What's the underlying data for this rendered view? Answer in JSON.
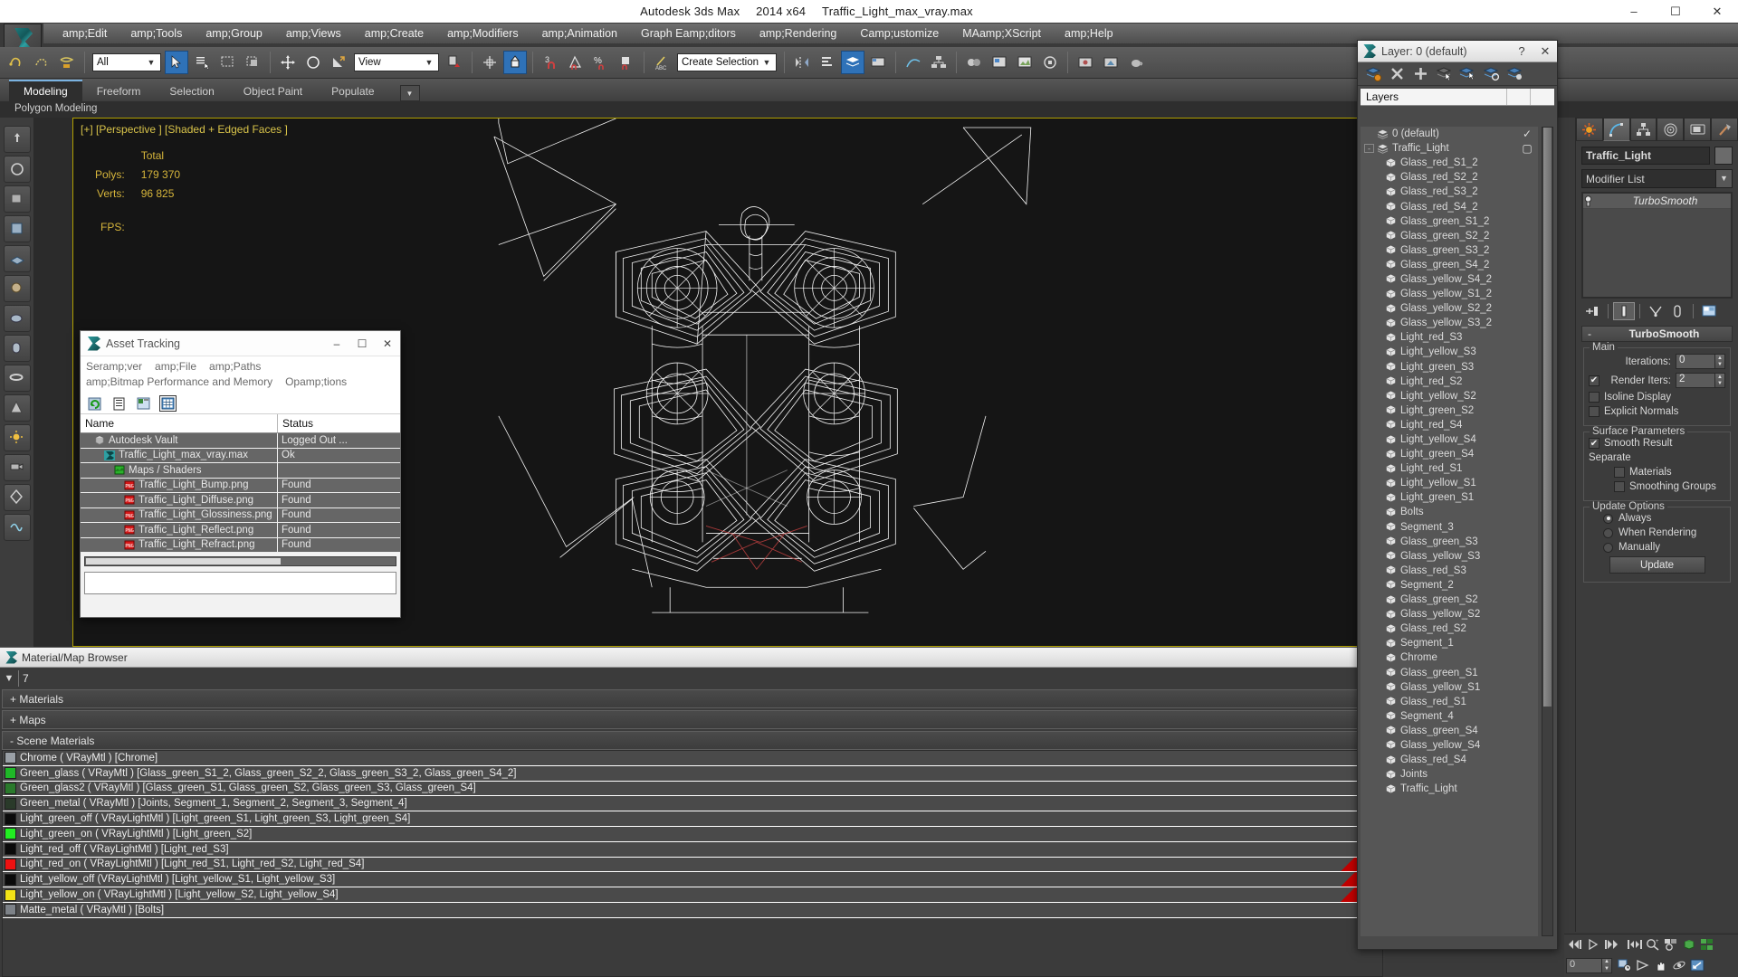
{
  "titlebar": {
    "app": "Autodesk 3ds Max",
    "version": "2014 x64",
    "file": "Traffic_Light_max_vray.max",
    "minimize": "–",
    "maximize": "☐",
    "close": "✕"
  },
  "menu": {
    "items": [
      "amp;Edit",
      "amp;Tools",
      "amp;Group",
      "amp;Views",
      "amp;Create",
      "amp;Modifiers",
      "amp;Animation",
      "Graph Eamp;ditors",
      "amp;Rendering",
      "Camp;ustomize",
      "MAamp;XScript",
      "amp;Help"
    ]
  },
  "toolbar": {
    "selection_filter": "All",
    "ref_coord_sys": "View",
    "named_selection_set": "Create Selection Se",
    "icons": [
      "undo-icon",
      "redo-icon",
      "select-link-icon",
      "unlink-icon",
      "bind-spacewarp-icon",
      "select-object-icon",
      "select-by-name-icon",
      "rect-selection-icon",
      "window-crossing-icon",
      "select-move-icon",
      "select-rotate-icon",
      "select-scale-icon",
      "use-pivot-icon",
      "use-center-icon",
      "snap-toggle-icon",
      "angle-snap-icon",
      "percent-snap-icon",
      "spinner-snap-icon",
      "named-sel-icon",
      "mirror-icon",
      "align-icon",
      "manage-layers-icon",
      "graphite-tools-icon",
      "curve-editor-icon",
      "schematic-view-icon",
      "material-editor-icon",
      "render-setup-icon",
      "render-frame-icon",
      "render-production-icon"
    ]
  },
  "ribbon": {
    "tabs": [
      "Modeling",
      "Freeform",
      "Selection",
      "Object Paint",
      "Populate"
    ],
    "active_tab": "Modeling",
    "subtitle": "Polygon Modeling",
    "more": "▼"
  },
  "viewport": {
    "label": "[+] [Perspective ] [Shaded + Edged Faces ]",
    "stats_header": "Total",
    "polys_label": "Polys:",
    "polys_value": "179 370",
    "verts_label": "Verts:",
    "verts_value": "96 825",
    "fps_label": "FPS:",
    "fps_value": ""
  },
  "asset_tracking": {
    "title": "Asset Tracking",
    "icon": "max-file-icon",
    "minimize": "–",
    "maximize": "☐",
    "close": "✕",
    "menu_line1": [
      "Seramp;ver",
      "amp;File",
      "amp;Paths"
    ],
    "menu_line2": [
      "amp;Bitmap Performance and Memory",
      "Opamp;tions"
    ],
    "tool_icons": [
      "refresh-icon",
      "list-view-icon",
      "details-view-icon",
      "grid-view-icon"
    ],
    "columns": [
      "Name",
      "Status"
    ],
    "rows": [
      {
        "name": "Autodesk Vault",
        "status": "Logged Out ...",
        "indent": 1,
        "icon": "vault-icon"
      },
      {
        "name": "Traffic_Light_max_vray.max",
        "status": "Ok",
        "indent": 2,
        "icon": "max-file-icon"
      },
      {
        "name": "Maps / Shaders",
        "status": "",
        "indent": 3,
        "icon": "maps-icon"
      },
      {
        "name": "Traffic_Light_Bump.png",
        "status": "Found",
        "indent": 4,
        "icon": "png-icon"
      },
      {
        "name": "Traffic_Light_Diffuse.png",
        "status": "Found",
        "indent": 4,
        "icon": "png-icon"
      },
      {
        "name": "Traffic_Light_Glossiness.png",
        "status": "Found",
        "indent": 4,
        "icon": "png-icon"
      },
      {
        "name": "Traffic_Light_Reflect.png",
        "status": "Found",
        "indent": 4,
        "icon": "png-icon"
      },
      {
        "name": "Traffic_Light_Refract.png",
        "status": "Found",
        "indent": 4,
        "icon": "png-icon"
      }
    ]
  },
  "material_browser": {
    "title": "Material/Map Browser",
    "icon": "max-file-icon",
    "close": "✕",
    "search_value": "7",
    "search_arrow": "▼",
    "groups": [
      {
        "sign": "+",
        "label": "Materials"
      },
      {
        "sign": "+",
        "label": "Maps"
      },
      {
        "sign": "-",
        "label": "Scene Materials"
      }
    ],
    "materials": [
      {
        "name": "Chrome",
        "type": "( VRayMtl )",
        "objects": "[Chrome]",
        "swatch": "#9aa0a6",
        "red": false
      },
      {
        "name": "Green_glass",
        "type": "( VRayMtl )",
        "objects": "[Glass_green_S1_2, Glass_green_S2_2, Glass_green_S3_2, Glass_green_S4_2]",
        "swatch": "#1fb728",
        "red": false
      },
      {
        "name": "Green_glass2",
        "type": "( VRayMtl )",
        "objects": "[Glass_green_S1, Glass_green_S2, Glass_green_S3, Glass_green_S4]",
        "swatch": "#2a7a2c",
        "red": false
      },
      {
        "name": "Green_metal",
        "type": "( VRayMtl )",
        "objects": "[Joints, Segment_1, Segment_2, Segment_3, Segment_4]",
        "swatch": "#2a3a2a",
        "red": false
      },
      {
        "name": "Light_green_off",
        "type": "( VRayLightMtl )",
        "objects": "[Light_green_S1, Light_green_S3, Light_green_S4]",
        "swatch": "#0a0a0a",
        "red": false
      },
      {
        "name": "Light_green_on",
        "type": "( VRayLightMtl )",
        "objects": "[Light_green_S2]",
        "swatch": "#22ee22",
        "red": false
      },
      {
        "name": "Light_red_off",
        "type": "( VRayLightMtl )",
        "objects": "[Light_red_S3]",
        "swatch": "#0a0a0a",
        "red": false
      },
      {
        "name": "Light_red_on",
        "type": "( VRayLightMtl )",
        "objects": "[Light_red_S1, Light_red_S2, Light_red_S4]",
        "swatch": "#ee1111",
        "red": true
      },
      {
        "name": "Light_yellow_off",
        "type": "(VRayLightMtl )",
        "objects": "[Light_yellow_S1, Light_yellow_S3]",
        "swatch": "#0a0a0a",
        "red": true
      },
      {
        "name": "Light_yellow_on",
        "type": "( VRayLightMtl )",
        "objects": "[Light_yellow_S2, Light_yellow_S4]",
        "swatch": "#f2e317",
        "red": true
      },
      {
        "name": "Matte_metal",
        "type": "( VRayMtl )",
        "objects": "[Bolts]",
        "swatch": "#7d8288",
        "red": false
      }
    ]
  },
  "layer_dialog": {
    "title": "Layer: 0 (default)",
    "icon": "max-file-icon",
    "help": "?",
    "close": "✕",
    "tool_icons": [
      "create-new-layer-icon",
      "delete-layer-icon",
      "add-selection-icon",
      "select-objects-in-layer-icon",
      "set-current-layer-icon",
      "select-highlighted-layer-icon",
      "layer-properties-icon"
    ],
    "column_header": "Layers",
    "rows": [
      {
        "name": "0 (default)",
        "indent": 1,
        "expander": "",
        "mark": "✓",
        "icon": "layer-icon"
      },
      {
        "name": "Traffic_Light",
        "indent": 0,
        "expander": "-",
        "mark": "▢",
        "icon": "layer-icon"
      },
      {
        "name": "Glass_red_S1_2",
        "indent": 2,
        "expander": "",
        "mark": "",
        "icon": "object-icon"
      },
      {
        "name": "Glass_red_S2_2",
        "indent": 2,
        "expander": "",
        "mark": "",
        "icon": "object-icon"
      },
      {
        "name": "Glass_red_S3_2",
        "indent": 2,
        "expander": "",
        "mark": "",
        "icon": "object-icon"
      },
      {
        "name": "Glass_red_S4_2",
        "indent": 2,
        "expander": "",
        "mark": "",
        "icon": "object-icon"
      },
      {
        "name": "Glass_green_S1_2",
        "indent": 2,
        "expander": "",
        "mark": "",
        "icon": "object-icon"
      },
      {
        "name": "Glass_green_S2_2",
        "indent": 2,
        "expander": "",
        "mark": "",
        "icon": "object-icon"
      },
      {
        "name": "Glass_green_S3_2",
        "indent": 2,
        "expander": "",
        "mark": "",
        "icon": "object-icon"
      },
      {
        "name": "Glass_green_S4_2",
        "indent": 2,
        "expander": "",
        "mark": "",
        "icon": "object-icon"
      },
      {
        "name": "Glass_yellow_S4_2",
        "indent": 2,
        "expander": "",
        "mark": "",
        "icon": "object-icon"
      },
      {
        "name": "Glass_yellow_S1_2",
        "indent": 2,
        "expander": "",
        "mark": "",
        "icon": "object-icon"
      },
      {
        "name": "Glass_yellow_S2_2",
        "indent": 2,
        "expander": "",
        "mark": "",
        "icon": "object-icon"
      },
      {
        "name": "Glass_yellow_S3_2",
        "indent": 2,
        "expander": "",
        "mark": "",
        "icon": "object-icon"
      },
      {
        "name": "Light_red_S3",
        "indent": 2,
        "expander": "",
        "mark": "",
        "icon": "object-icon"
      },
      {
        "name": "Light_yellow_S3",
        "indent": 2,
        "expander": "",
        "mark": "",
        "icon": "object-icon"
      },
      {
        "name": "Light_green_S3",
        "indent": 2,
        "expander": "",
        "mark": "",
        "icon": "object-icon"
      },
      {
        "name": "Light_red_S2",
        "indent": 2,
        "expander": "",
        "mark": "",
        "icon": "object-icon"
      },
      {
        "name": "Light_yellow_S2",
        "indent": 2,
        "expander": "",
        "mark": "",
        "icon": "object-icon"
      },
      {
        "name": "Light_green_S2",
        "indent": 2,
        "expander": "",
        "mark": "",
        "icon": "object-icon"
      },
      {
        "name": "Light_red_S4",
        "indent": 2,
        "expander": "",
        "mark": "",
        "icon": "object-icon"
      },
      {
        "name": "Light_yellow_S4",
        "indent": 2,
        "expander": "",
        "mark": "",
        "icon": "object-icon"
      },
      {
        "name": "Light_green_S4",
        "indent": 2,
        "expander": "",
        "mark": "",
        "icon": "object-icon"
      },
      {
        "name": "Light_red_S1",
        "indent": 2,
        "expander": "",
        "mark": "",
        "icon": "object-icon"
      },
      {
        "name": "Light_yellow_S1",
        "indent": 2,
        "expander": "",
        "mark": "",
        "icon": "object-icon"
      },
      {
        "name": "Light_green_S1",
        "indent": 2,
        "expander": "",
        "mark": "",
        "icon": "object-icon"
      },
      {
        "name": "Bolts",
        "indent": 2,
        "expander": "",
        "mark": "",
        "icon": "object-icon"
      },
      {
        "name": "Segment_3",
        "indent": 2,
        "expander": "",
        "mark": "",
        "icon": "object-icon"
      },
      {
        "name": "Glass_green_S3",
        "indent": 2,
        "expander": "",
        "mark": "",
        "icon": "object-icon"
      },
      {
        "name": "Glass_yellow_S3",
        "indent": 2,
        "expander": "",
        "mark": "",
        "icon": "object-icon"
      },
      {
        "name": "Glass_red_S3",
        "indent": 2,
        "expander": "",
        "mark": "",
        "icon": "object-icon"
      },
      {
        "name": "Segment_2",
        "indent": 2,
        "expander": "",
        "mark": "",
        "icon": "object-icon"
      },
      {
        "name": "Glass_green_S2",
        "indent": 2,
        "expander": "",
        "mark": "",
        "icon": "object-icon"
      },
      {
        "name": "Glass_yellow_S2",
        "indent": 2,
        "expander": "",
        "mark": "",
        "icon": "object-icon"
      },
      {
        "name": "Glass_red_S2",
        "indent": 2,
        "expander": "",
        "mark": "",
        "icon": "object-icon"
      },
      {
        "name": "Segment_1",
        "indent": 2,
        "expander": "",
        "mark": "",
        "icon": "object-icon"
      },
      {
        "name": "Chrome",
        "indent": 2,
        "expander": "",
        "mark": "",
        "icon": "object-icon"
      },
      {
        "name": "Glass_green_S1",
        "indent": 2,
        "expander": "",
        "mark": "",
        "icon": "object-icon"
      },
      {
        "name": "Glass_yellow_S1",
        "indent": 2,
        "expander": "",
        "mark": "",
        "icon": "object-icon"
      },
      {
        "name": "Glass_red_S1",
        "indent": 2,
        "expander": "",
        "mark": "",
        "icon": "object-icon"
      },
      {
        "name": "Segment_4",
        "indent": 2,
        "expander": "",
        "mark": "",
        "icon": "object-icon"
      },
      {
        "name": "Glass_green_S4",
        "indent": 2,
        "expander": "",
        "mark": "",
        "icon": "object-icon"
      },
      {
        "name": "Glass_yellow_S4",
        "indent": 2,
        "expander": "",
        "mark": "",
        "icon": "object-icon"
      },
      {
        "name": "Glass_red_S4",
        "indent": 2,
        "expander": "",
        "mark": "",
        "icon": "object-icon"
      },
      {
        "name": "Joints",
        "indent": 2,
        "expander": "",
        "mark": "",
        "icon": "object-icon"
      },
      {
        "name": "Traffic_Light",
        "indent": 2,
        "expander": "",
        "mark": "",
        "icon": "object-icon"
      }
    ]
  },
  "command_panel": {
    "tabs": [
      "create-tab",
      "modify-tab",
      "hierarchy-tab",
      "motion-tab",
      "display-tab",
      "utilities-tab"
    ],
    "active_tab_index": 1,
    "object_name": "Traffic_Light",
    "modifier_list_label": "Modifier List",
    "modifier_list_caret": "▼",
    "stack": [
      {
        "name": "TurboSmooth",
        "light_icon": "lightbulb-icon"
      }
    ],
    "stack_buttons": [
      "pin-stack-icon",
      "show-end-result-icon",
      "make-unique-icon",
      "remove-modifier-icon",
      "configure-sets-icon"
    ],
    "rollout": {
      "sign": "-",
      "title": "TurboSmooth",
      "groups": [
        {
          "label": "Main",
          "fields": [
            {
              "kind": "spinner",
              "label": "Iterations:",
              "value": "0"
            },
            {
              "kind": "check_spinner",
              "label": "Render Iters:",
              "value": "2",
              "checked": true
            },
            {
              "kind": "checkbox",
              "label": "Isoline Display",
              "checked": false
            },
            {
              "kind": "checkbox",
              "label": "Explicit Normals",
              "checked": false
            }
          ]
        },
        {
          "label": "Surface Parameters",
          "fields": [
            {
              "kind": "checkbox",
              "label": "Smooth Result",
              "checked": true
            },
            {
              "kind": "text",
              "label": "Separate"
            },
            {
              "kind": "checkbox_indent",
              "label": "Materials",
              "checked": false
            },
            {
              "kind": "checkbox_indent",
              "label": "Smoothing Groups",
              "checked": false
            }
          ]
        },
        {
          "label": "Update Options",
          "fields": [
            {
              "kind": "radio",
              "label": "Always",
              "checked": true
            },
            {
              "kind": "radio",
              "label": "When Rendering",
              "checked": false
            },
            {
              "kind": "radio",
              "label": "Manually",
              "checked": false
            },
            {
              "kind": "button",
              "label": "Update"
            }
          ]
        }
      ]
    }
  },
  "anim_bar": {
    "frame_value": "0",
    "buttons_top": [
      "prev-key-icon",
      "play-animation-icon",
      "next-key-icon",
      "key-mode-icon",
      "zoom-region-icon",
      "zoom-extents-all-icon",
      "field-of-view-icon",
      "zoom-extents-icon"
    ],
    "buttons_bottom": [
      "time-configuration-icon",
      "arc-rotate-icon",
      "pan-view-icon",
      "orbit-icon",
      "maximize-viewport-icon"
    ]
  },
  "left_rail": {
    "icons": [
      "move-tool-icon",
      "rotate-tool-icon",
      "scale-tool-icon",
      "box-tool-icon",
      "plane-tool-icon",
      "paint-tool-icon",
      "sphere-tool-icon",
      "cylinder-tool-icon",
      "torus-tool-icon",
      "cone-tool-icon",
      "light-tool-icon",
      "camera-tool-icon",
      "helper-tool-icon",
      "warp-tool-icon"
    ]
  }
}
